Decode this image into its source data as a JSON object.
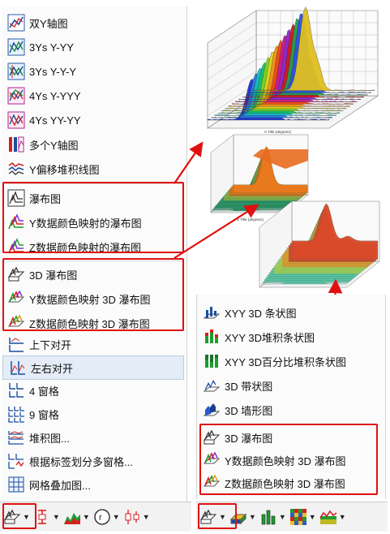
{
  "left_menu": {
    "items": [
      {
        "label": "双Y轴图",
        "icon": "double-y-axis-icon"
      },
      {
        "label": "3Ys Y-YY",
        "icon": "3ys-y-yy-icon"
      },
      {
        "label": "3Ys Y-Y-Y",
        "icon": "3ys-y-y-y-icon"
      },
      {
        "label": "4Ys Y-YYY",
        "icon": "4ys-y-yyy-icon"
      },
      {
        "label": "4Ys YY-YY",
        "icon": "4ys-yy-yy-icon"
      },
      {
        "label": "多个Y轴图",
        "icon": "multi-y-axis-icon"
      },
      {
        "label": "Y偏移堆积线图",
        "icon": "y-offset-stacked-lines-icon"
      },
      {
        "label": "瀑布图",
        "icon": "waterfall-icon"
      },
      {
        "label": "Y数据颜色映射的瀑布图",
        "icon": "waterfall-y-colormap-icon"
      },
      {
        "label": "Z数据颜色映射的瀑布图",
        "icon": "waterfall-z-colormap-icon"
      },
      {
        "label": "3D 瀑布图",
        "icon": "3d-waterfall-icon"
      },
      {
        "label": "Y数据颜色映射 3D 瀑布图",
        "icon": "3d-waterfall-y-colormap-icon"
      },
      {
        "label": "Z数据颜色映射 3D 瀑布图",
        "icon": "3d-waterfall-z-colormap-icon"
      },
      {
        "label": "上下对开",
        "icon": "vertical-2-panel-icon"
      },
      {
        "label": "左右对开",
        "icon": "horizontal-2-panel-icon"
      },
      {
        "label": "4 窗格",
        "icon": "4-panel-icon"
      },
      {
        "label": "9 窗格",
        "icon": "9-panel-icon"
      },
      {
        "label": "堆积图...",
        "icon": "stack-icon"
      },
      {
        "label": "根据标签划分多窗格...",
        "icon": "panel-by-label-icon"
      },
      {
        "label": "网格叠加图...",
        "icon": "grid-overlay-icon"
      }
    ]
  },
  "right_menu": {
    "items": [
      {
        "label": "XYY 3D 条状图",
        "icon": "xyy-3d-bars-icon"
      },
      {
        "label": "XYY 3D堆积条状图",
        "icon": "xyy-3d-stacked-bars-icon"
      },
      {
        "label": "XYY 3D百分比堆积条状图",
        "icon": "xyy-3d-100-stacked-bars-icon"
      },
      {
        "label": "3D 带状图",
        "icon": "3d-ribbons-icon"
      },
      {
        "label": "3D 墙形图",
        "icon": "3d-walls-icon"
      },
      {
        "label": "3D 瀑布图",
        "icon": "3d-waterfall-icon"
      },
      {
        "label": "Y数据颜色映射 3D 瀑布图",
        "icon": "3d-waterfall-y-colormap-icon"
      },
      {
        "label": "Z数据颜色映射 3D 瀑布图",
        "icon": "3d-waterfall-z-colormap-icon"
      }
    ]
  },
  "toolbar_left": [
    "waterfall-dropdown-icon",
    "error-bar-icon",
    "area-chart-icon",
    "polar-icon",
    "box-plot-icon"
  ],
  "toolbar_right": [
    "3d-waterfall-dropdown-icon",
    "3d-surface-icon",
    "3d-bars-icon",
    "heatmap-icon",
    "contour-icon"
  ],
  "thumbs": {
    "top_x_label": "X Title (degrees)",
    "mid_x_label": "X Title (degrees)"
  },
  "colors": {
    "highlight_red": "#e01010",
    "menu_hover": "#e3ecf7"
  }
}
